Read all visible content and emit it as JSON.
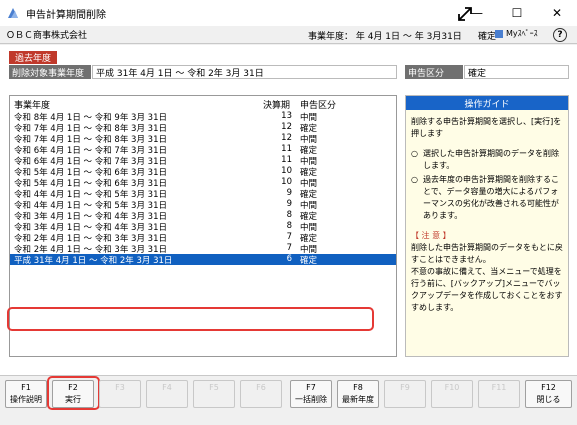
{
  "window": {
    "title": "申告計算期間削除",
    "minimize": "—",
    "maximize": "☐",
    "close": "✕"
  },
  "info": {
    "company": "ＯＢＣ商事株式会社",
    "fiscal_year": "事業年度：  年 4月 1日 ～  年 3月31日",
    "confirm": "確定",
    "myspace": "Myｽﾍﾟｰｽ",
    "help": "?"
  },
  "main": {
    "past_badge": "過去年度",
    "del_label": "削除対象事業年度",
    "del_value": "平成 31年  4月  1日 ～ 令和  2年  3月 31日",
    "decl_label": "申告区分",
    "decl_value": "確定"
  },
  "list": {
    "col_year": "事業年度",
    "col_period": "決算期",
    "col_type": "申告区分",
    "rows": [
      {
        "year": "令和  8年  4月  1日 ～ 令和  9年  3月 31日",
        "period": "13",
        "type": "中間"
      },
      {
        "year": "令和  7年  4月  1日 ～ 令和  8年  3月 31日",
        "period": "12",
        "type": "確定"
      },
      {
        "year": "令和  7年  4月  1日 ～ 令和  8年  3月 31日",
        "period": "12",
        "type": "中間"
      },
      {
        "year": "令和  6年  4月  1日 ～ 令和  7年  3月 31日",
        "period": "11",
        "type": "確定"
      },
      {
        "year": "令和  6年  4月  1日 ～ 令和  7年  3月 31日",
        "period": "11",
        "type": "中間"
      },
      {
        "year": "令和  5年  4月  1日 ～ 令和  6年  3月 31日",
        "period": "10",
        "type": "確定"
      },
      {
        "year": "令和  5年  4月  1日 ～ 令和  6年  3月 31日",
        "period": "10",
        "type": "中間"
      },
      {
        "year": "令和  4年  4月  1日 ～ 令和  5年  3月 31日",
        "period": "9",
        "type": "確定"
      },
      {
        "year": "令和  4年  4月  1日 ～ 令和  5年  3月 31日",
        "period": "9",
        "type": "中間"
      },
      {
        "year": "令和  3年  4月  1日 ～ 令和  4年  3月 31日",
        "period": "8",
        "type": "確定"
      },
      {
        "year": "令和  3年  4月  1日 ～ 令和  4年  3月 31日",
        "period": "8",
        "type": "中間"
      },
      {
        "year": "令和  2年  4月  1日 ～ 令和  3年  3月 31日",
        "period": "7",
        "type": "確定"
      },
      {
        "year": "令和  2年  4月  1日 ～ 令和  3年  3月 31日",
        "period": "7",
        "type": "中間"
      },
      {
        "year": "平成 31年  4月  1日 ～ 令和  2年  3月 31日",
        "period": "6",
        "type": "確定",
        "selected": true
      }
    ]
  },
  "guide": {
    "title": "操作ガイド",
    "intro": "削除する申告計算期間を選択し、[実行]を押します",
    "bullet": "○",
    "item1": "選択した申告計算期間のデータを削除します。",
    "item2": "過去年度の申告計算期間を削除することで、データ容量の増大によるパフォーマンスの劣化が改善される可能性があります。",
    "note_title": "【 注 意 】",
    "note1": "削除した申告計算期間のデータをもとに戻すことはできません。",
    "note2": "不意の事故に備えて、当メニューで処理を行う前に、[バックアップ]メニューでバックアップデータを作成しておくことをおすすめします。"
  },
  "fkeys": [
    {
      "key": "F1",
      "label": "操作説明",
      "enabled": true
    },
    {
      "key": "F2",
      "label": "実行",
      "enabled": true
    },
    {
      "key": "F3",
      "label": "",
      "enabled": false
    },
    {
      "key": "F4",
      "label": "",
      "enabled": false
    },
    {
      "key": "F5",
      "label": "",
      "enabled": false
    },
    {
      "key": "F6",
      "label": "",
      "enabled": false
    },
    {
      "key": "F7",
      "label": "一括削除",
      "enabled": true
    },
    {
      "key": "F8",
      "label": "最新年度",
      "enabled": true
    },
    {
      "key": "F9",
      "label": "",
      "enabled": false
    },
    {
      "key": "F10",
      "label": "",
      "enabled": false
    },
    {
      "key": "F11",
      "label": "",
      "enabled": false
    },
    {
      "key": "F12",
      "label": "閉じる",
      "enabled": true
    }
  ],
  "colors": {
    "accent_red": "#e53935",
    "selection_blue": "#1060c0",
    "guide_header": "#1864c8",
    "badge_red": "#c0392b"
  }
}
